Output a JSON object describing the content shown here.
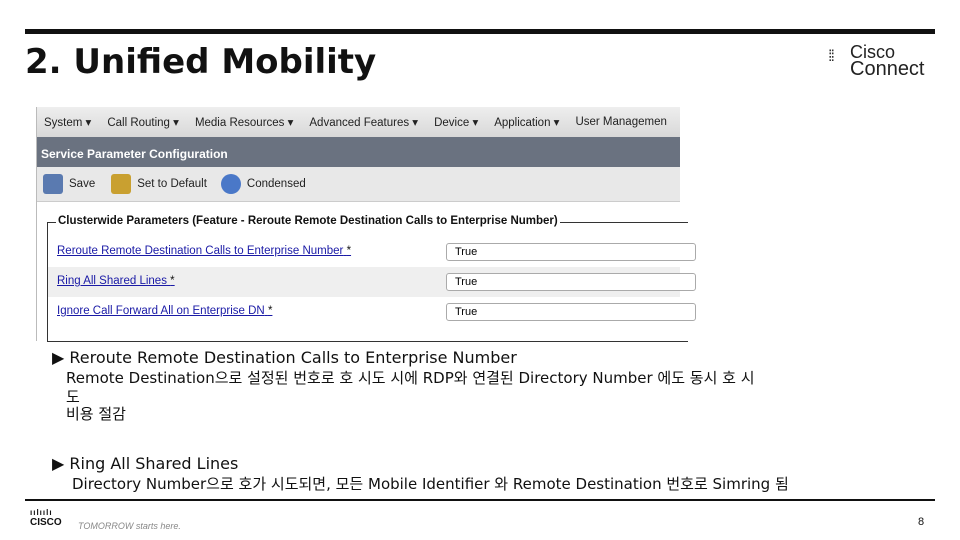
{
  "title": "2. Unified Mobility",
  "logo": {
    "line1": "Cisco",
    "line2": "Connect"
  },
  "menu": [
    "System ▾",
    "Call Routing ▾",
    "Media Resources ▾",
    "Advanced Features ▾",
    "Device ▾",
    "Application ▾",
    "User Managemen"
  ],
  "header": "Service Parameter Configuration",
  "toolbar": {
    "save": "Save",
    "default": "Set to Default",
    "condensed": "Condensed"
  },
  "section": "Clusterwide Parameters (Feature - Reroute Remote Destination Calls to Enterprise Number)",
  "params": [
    {
      "label": "Reroute Remote Destination Calls to Enterprise Number",
      "req": "*",
      "value": "True"
    },
    {
      "label": "Ring All Shared Lines",
      "req": "*",
      "value": "True"
    },
    {
      "label": "Ignore Call Forward All on Enterprise DN",
      "req": "*",
      "value": "True"
    }
  ],
  "bullets": [
    {
      "head": "▶ Reroute Remote Destination Calls to Enterprise Number",
      "l1": "Remote Destination으로 설정된 번호로 호 시도 시에 RDP와 연결된 Directory Number 에도 동시 호 시",
      "l2": "도",
      "l3": "비용 절감"
    },
    {
      "head": "▶ Ring All Shared Lines",
      "l1": "Directory Number으로 호가 시도되면, 모든 Mobile Identifier 와 Remote Destination 번호로 Simring 됨"
    }
  ],
  "footer": {
    "brand": "CISCO",
    "tagline": "TOMORROW starts here.",
    "page": "8"
  }
}
